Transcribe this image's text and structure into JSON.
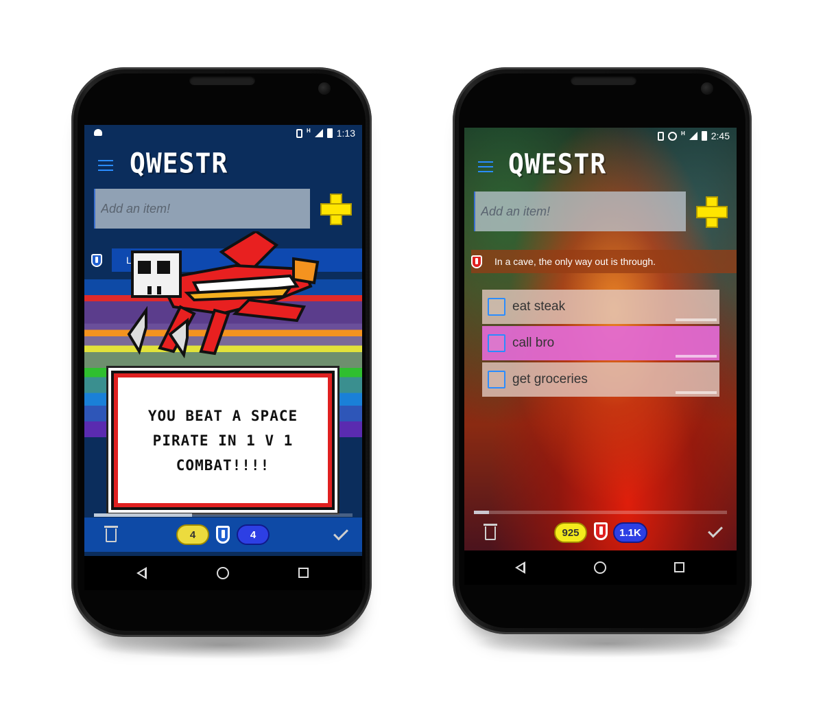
{
  "left_phone": {
    "status": {
      "time": "1:13"
    },
    "app": {
      "logo": "QWESTR",
      "add_placeholder": "Add an item!"
    },
    "quest_text": "Lost i",
    "dialog_message": "YOU BEAT A SPACE PIRATE IN 1 V 1 COMBAT!!!!",
    "bottom": {
      "gold": "4",
      "xp": "4"
    },
    "progress": 0.38
  },
  "right_phone": {
    "status": {
      "time": "2:45"
    },
    "app": {
      "logo": "QWESTR",
      "add_placeholder": "Add an item!"
    },
    "quest_text": "In a cave, the only way out is through.",
    "tasks": [
      {
        "label": "eat steak",
        "color": "#d8c8c0"
      },
      {
        "label": "call bro",
        "color": "#e36bd6"
      },
      {
        "label": "get groceries",
        "color": "#d8c8c0"
      }
    ],
    "bottom": {
      "gold": "925",
      "xp": "1.1K"
    },
    "progress": 0.06
  },
  "colors": {
    "accent_blue": "#2a8cff",
    "gold": "#ffe500",
    "xp_blue": "#2d3fe4",
    "dialog_border": "#e02020",
    "shield_blue": "#1f5fd0",
    "shield_red": "#e02020"
  },
  "icons": [
    "android-icon",
    "vibrate-icon",
    "signal-icon",
    "battery-icon",
    "alarm-icon",
    "menu-icon",
    "add-cross-icon",
    "shield-icon",
    "trash-icon",
    "check-icon",
    "back-icon",
    "home-icon",
    "recents-icon"
  ]
}
